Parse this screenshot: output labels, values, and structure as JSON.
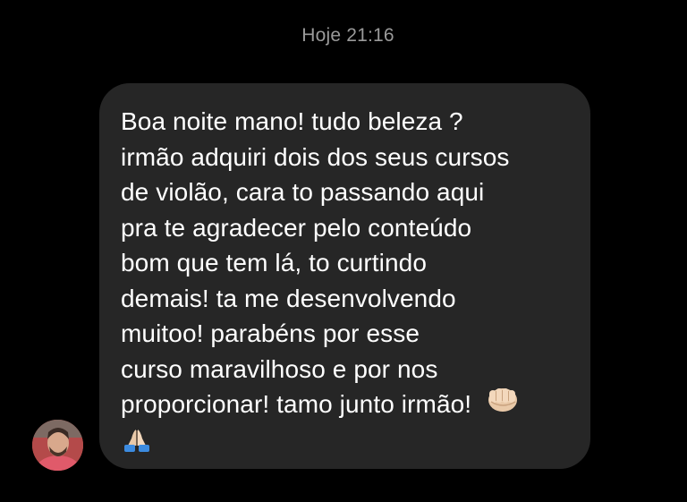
{
  "header": {
    "timestamp": "Hoje 21:16"
  },
  "message": {
    "lines": [
      "Boa noite mano! tudo beleza ?",
      "irmão adquiri dois dos seus cursos",
      "de violão, cara to passando aqui",
      "pra te agradecer pelo conteúdo",
      "bom que tem lá, to curtindo",
      "demais! ta me desenvolvendo",
      "muitoo! parabéns por esse",
      "curso maravilhoso e por nos",
      "proporcionar! tamo junto irmão!"
    ],
    "emojis": [
      "fist-bump-icon",
      "folded-hands-icon"
    ]
  },
  "sender": {
    "avatar": "avatar-photo"
  },
  "colors": {
    "background": "#000000",
    "bubble": "#262626",
    "text": "#ffffff",
    "timestamp": "#9a9a9a"
  }
}
